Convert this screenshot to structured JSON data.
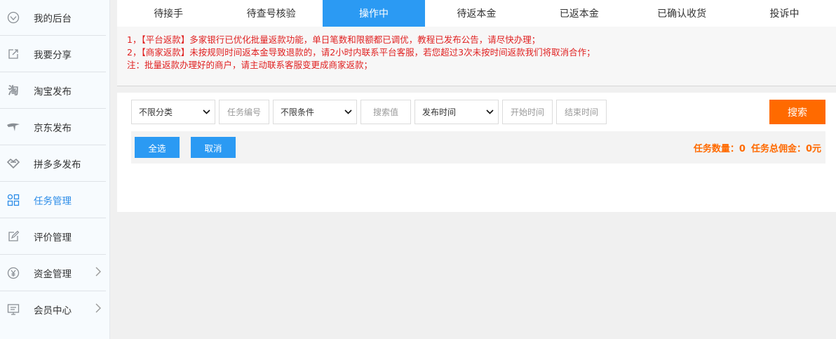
{
  "sidebar": {
    "items": [
      {
        "label": "我的后台",
        "icon": "diamond-icon"
      },
      {
        "label": "我要分享",
        "icon": "share-icon"
      },
      {
        "label": "淘宝发布",
        "icon": "taobao-icon"
      },
      {
        "label": "京东发布",
        "icon": "jd-icon"
      },
      {
        "label": "拼多多发布",
        "icon": "pdd-icon"
      },
      {
        "label": "任务管理",
        "icon": "grid-icon"
      },
      {
        "label": "评价管理",
        "icon": "edit-icon"
      },
      {
        "label": "资金管理",
        "icon": "yen-icon"
      },
      {
        "label": "会员中心",
        "icon": "monitor-icon"
      }
    ],
    "active": "任务管理"
  },
  "tabs": [
    {
      "label": "待接手"
    },
    {
      "label": "待查号核验"
    },
    {
      "label": "操作中"
    },
    {
      "label": "待返本金"
    },
    {
      "label": "已返本金"
    },
    {
      "label": "已确认收货"
    },
    {
      "label": "投诉中"
    }
  ],
  "active_tab": "操作中",
  "notice": [
    "1，【平台返款】多家银行已优化批量返款功能，单日笔数和限额都已调优，教程已发布公告，请尽快办理；",
    "2，【商家返款】未按规则时间返本金导致退款的，请2小时内联系平台客服，若您超过3次未按时间返款我们将取消合作；",
    "注：批量返款办理好的商户，请主动联系客服变更成商家返款；"
  ],
  "filters": {
    "category": "不限分类",
    "task_no": "任务编号",
    "condition": "不限条件",
    "search_value": "搜索值",
    "time_type": "发布时间",
    "start_time": "开始时间",
    "end_time": "结束时间",
    "search_btn": "搜索"
  },
  "actions": {
    "select_all": "全选",
    "cancel": "取消"
  },
  "summary": {
    "task_count": "任务数量：0",
    "total_commission": "任务总佣金：0元"
  },
  "colors": {
    "accent": "#2b9af3",
    "orange": "#ff6a00",
    "notice_red": "#e02020"
  }
}
